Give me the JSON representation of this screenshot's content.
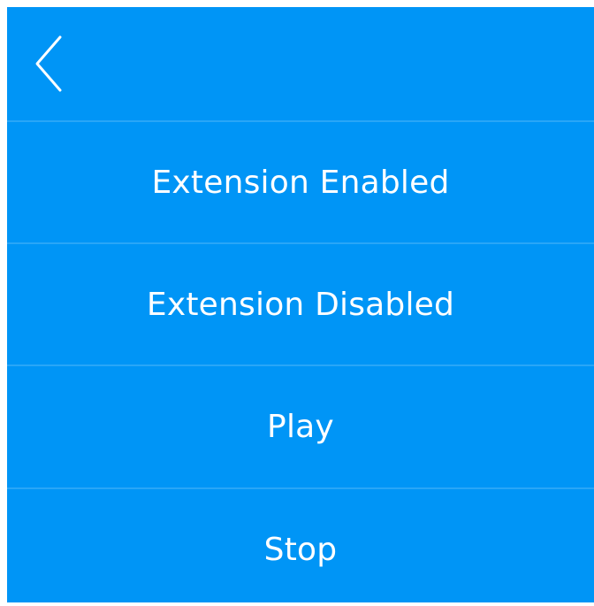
{
  "header": {
    "back_icon": "chevron-left-icon"
  },
  "menu": {
    "items": [
      {
        "label": "Extension Enabled"
      },
      {
        "label": "Extension Disabled"
      },
      {
        "label": "Play"
      },
      {
        "label": "Stop"
      }
    ]
  },
  "colors": {
    "background": "#0095f6",
    "text": "#ffffff",
    "divider": "#40b0f8"
  }
}
